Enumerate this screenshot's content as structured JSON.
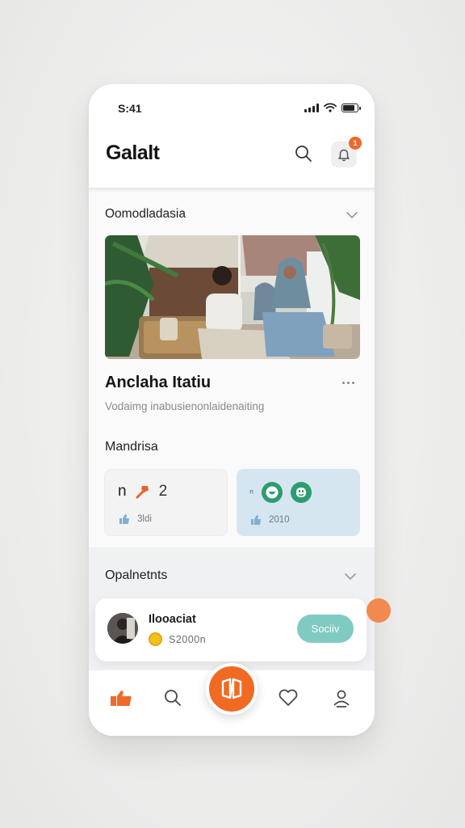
{
  "status_bar": {
    "time": "S:41"
  },
  "header": {
    "title": "Galalt",
    "notification_count": "1"
  },
  "section_featured": {
    "title": "Oomodladasia",
    "card_title": "Anclaha Itatiu",
    "card_subtitle": "Vodaimg inabusienonlaidenaiting"
  },
  "section_categories": {
    "title": "Mandrisa",
    "tiles": [
      {
        "letter": "n",
        "number": "2",
        "footer": "3ldi"
      },
      {
        "letter": "ⁿ",
        "footer": "2010"
      }
    ]
  },
  "section_products": {
    "title": "Opalnetnts",
    "item": {
      "name": "Ilooaciat",
      "price": "S2000n",
      "button": "Sociiv"
    }
  },
  "colors": {
    "accent": "#f16a23",
    "teal_button": "#7fcbc2",
    "tile_blue": "#d5e6f1",
    "green_face": "#2d9d6f"
  },
  "bottom_nav": [
    "home-icon",
    "search-icon",
    "create-icon",
    "heart-icon",
    "profile-icon"
  ]
}
